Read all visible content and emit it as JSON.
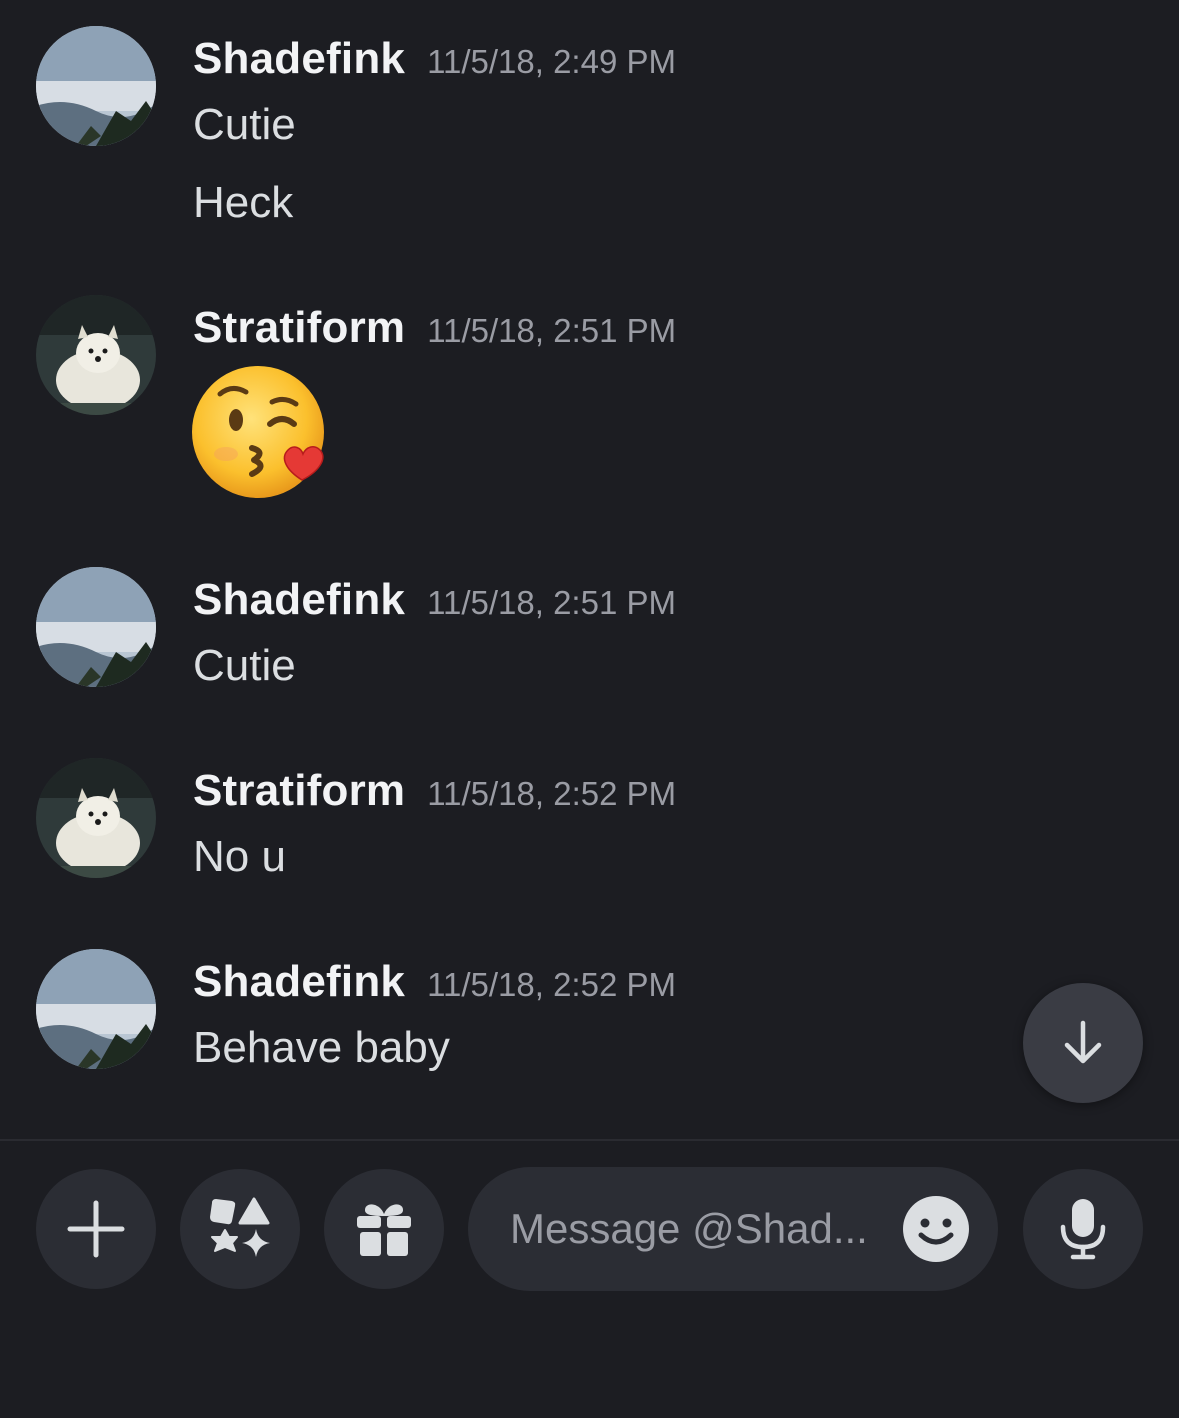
{
  "messages": [
    {
      "author": "Shadefink",
      "timestamp": "11/5/18, 2:49 PM",
      "lines": [
        "Cutie",
        "Heck"
      ]
    },
    {
      "author": "Stratiform",
      "timestamp": "11/5/18, 2:51 PM",
      "emoji": "face-blowing-a-kiss"
    },
    {
      "author": "Shadefink",
      "timestamp": "11/5/18, 2:51 PM",
      "lines": [
        "Cutie"
      ]
    },
    {
      "author": "Stratiform",
      "timestamp": "11/5/18, 2:52 PM",
      "lines": [
        "No u"
      ]
    },
    {
      "author": "Shadefink",
      "timestamp": "11/5/18, 2:52 PM",
      "lines": [
        "Behave baby"
      ]
    }
  ],
  "composer": {
    "placeholder": "Message @Shad...",
    "buttons": [
      "plus-icon",
      "apps-icon",
      "gift-icon",
      "emoji-icon",
      "microphone-icon"
    ]
  },
  "jump_button_icon": "arrow-down-icon",
  "colors": {
    "background": "#1c1d22",
    "button": "#2b2d34",
    "author": "#f2f3f5",
    "timestamp": "#9a9ca4",
    "text": "#dbdee1"
  }
}
